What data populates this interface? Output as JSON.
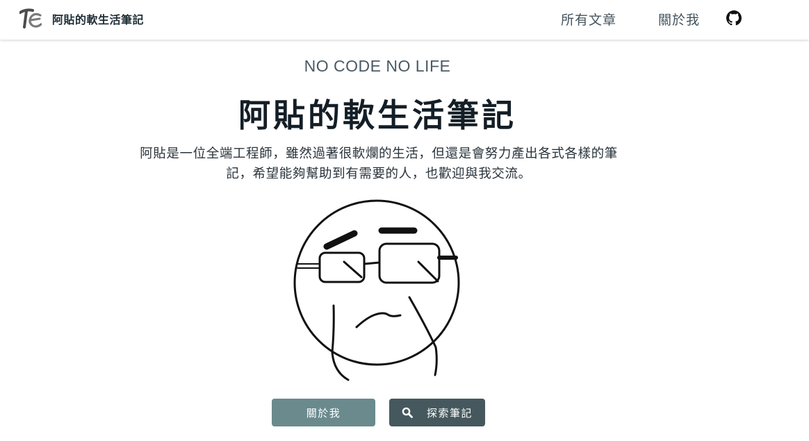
{
  "nav": {
    "brand_title": "阿貼的軟生活筆記",
    "brand_logo_icon": "te-monogram-logo",
    "links": [
      {
        "label": "所有文章"
      },
      {
        "label": "關於我"
      }
    ],
    "github_icon": "github-icon"
  },
  "hero": {
    "tagline": "NO CODE NO LIFE",
    "title": "阿貼的軟生活筆記",
    "description_line1": "阿貼是一位全端工程師，雖然過著很軟爛的生活，但還是會努力產出各式各樣的筆",
    "description_line2": "記，希望能夠幫助到有需要的人，也歡迎與我交流。",
    "illustration": "hand-drawn-face-with-glasses"
  },
  "actions": {
    "about_label": "關於我",
    "explore_label": "探索筆記",
    "explore_icon": "search-icon"
  },
  "colors": {
    "about_button": "#6a8a8d",
    "explore_button": "#45585e",
    "nav_text": "#44535d",
    "title_text": "#141e26"
  }
}
